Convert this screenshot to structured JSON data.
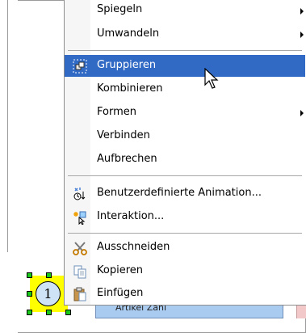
{
  "document": {
    "shape_label": "1",
    "rect_label": "Artikel Zahl"
  },
  "menu": {
    "items": [
      {
        "label": "Spiegeln",
        "submenu": true
      },
      {
        "label": "Umwandeln",
        "submenu": true
      },
      {
        "label": "Gruppieren",
        "highlighted": true,
        "icon": "group-icon"
      },
      {
        "label": "Kombinieren"
      },
      {
        "label": "Formen",
        "submenu": true
      },
      {
        "label": "Verbinden"
      },
      {
        "label": "Aufbrechen"
      },
      {
        "label": "Benutzerdefinierte Animation...",
        "icon": "animation-icon"
      },
      {
        "label": "Interaktion...",
        "icon": "interaction-icon"
      },
      {
        "label": "Ausschneiden",
        "icon": "scissors-icon"
      },
      {
        "label": "Kopieren",
        "icon": "copy-icon"
      },
      {
        "label": "Einfügen",
        "icon": "paste-icon"
      }
    ]
  },
  "colors": {
    "highlight": "#316ac5",
    "selection_fill": "#ffff00",
    "handle": "#19c919",
    "rect_fill": "#a9cbf0"
  }
}
